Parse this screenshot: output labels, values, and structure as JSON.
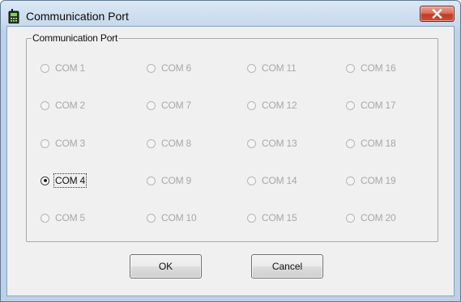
{
  "window": {
    "title": "Communication Port"
  },
  "group": {
    "label": "Communication Port"
  },
  "ports": {
    "selected": "COM 4",
    "columns": [
      [
        "COM 1",
        "COM 2",
        "COM 3",
        "COM 4",
        "COM 5"
      ],
      [
        "COM 6",
        "COM 7",
        "COM 8",
        "COM 9",
        "COM 10"
      ],
      [
        "COM 11",
        "COM 12",
        "COM 13",
        "COM 14",
        "COM 15"
      ],
      [
        "COM 16",
        "COM 17",
        "COM 18",
        "COM 19",
        "COM 20"
      ]
    ]
  },
  "buttons": {
    "ok_label": "OK",
    "cancel_label": "Cancel"
  },
  "icons": {
    "app": "radio-device-icon",
    "close": "close-icon"
  },
  "colors": {
    "close_button": "#c9503b",
    "disabled_text": "#a8a8a8",
    "dialog_face": "#f0f0f0"
  }
}
